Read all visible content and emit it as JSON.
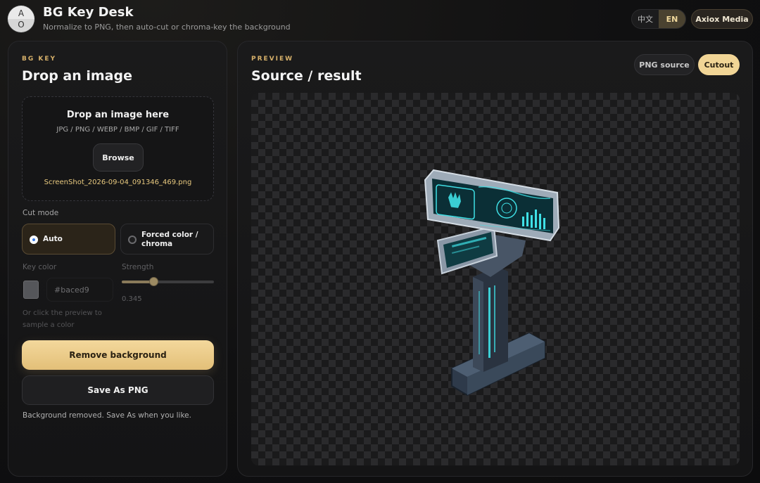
{
  "header": {
    "avatar_top": "A",
    "avatar_bottom": "O",
    "title": "BG Key Desk",
    "subtitle": "Normalize to PNG, then auto-cut or chroma-key the background",
    "lang_zh": "中文",
    "lang_en": "EN",
    "active_lang": "EN",
    "brand_button": "Axiox Media"
  },
  "left": {
    "eyebrow": "BG KEY",
    "title": "Drop an image",
    "dropzone": {
      "title": "Drop an image here",
      "formats": "JPG / PNG / WEBP / BMP / GIF / TIFF",
      "browse_label": "Browse",
      "filename": "ScreenShot_2026-09-04_091346_469.png"
    },
    "cut_mode_label": "Cut mode",
    "modes": [
      {
        "label": "Auto",
        "selected": true
      },
      {
        "label": "Forced color / chroma",
        "selected": false
      }
    ],
    "key_color_label": "Key color",
    "key_color_value": "#baced9",
    "strength_label": "Strength",
    "strength_value": "0.345",
    "hint": "Or click the preview to sample a color",
    "remove_label": "Remove background",
    "save_label": "Save As PNG",
    "status": "Background removed. Save As when you like."
  },
  "right": {
    "eyebrow": "PREVIEW",
    "title": "Source / result",
    "view_png": "PNG source",
    "view_cutout": "Cutout",
    "active_view": "Cutout"
  },
  "colors": {
    "accent": "#f1d596",
    "accent_text": "#d6b06a",
    "file_text": "#e8c97f",
    "background": "#0f0f10",
    "screen_glow": "#3fe0e6"
  },
  "icons": {
    "avatar": "brand-avatar",
    "object": "kiosk-terminal-image"
  }
}
